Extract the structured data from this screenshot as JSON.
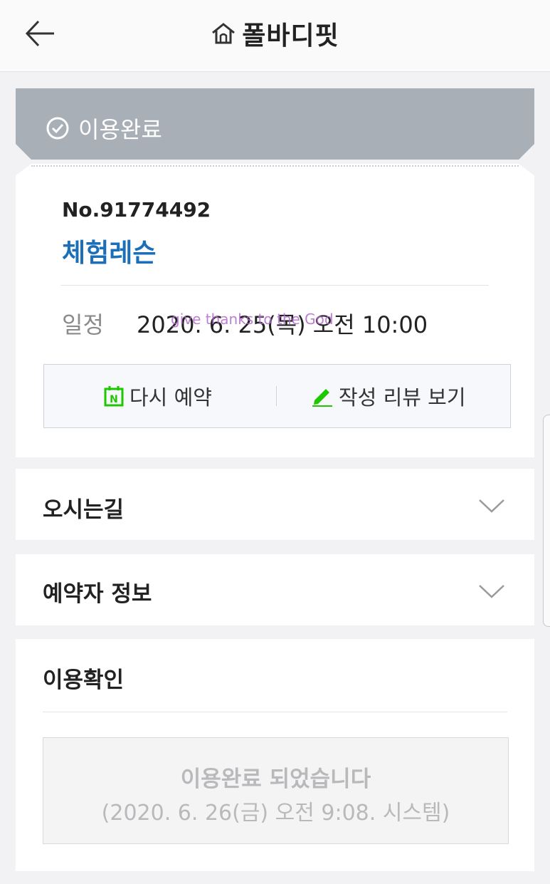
{
  "header": {
    "title": "폴바디핏",
    "back_icon": "arrow-left-icon",
    "home_icon": "home-icon"
  },
  "status": {
    "label": "이용완료",
    "icon": "check-circle-icon",
    "color": "#a8afb7"
  },
  "reservation": {
    "number": "No.91774492",
    "title": "체험레슨",
    "title_color": "#1a6fb8",
    "schedule_label": "일정",
    "schedule_value": "2020. 6. 25(목) 오전 10:00",
    "watermark": "give thanks to the God"
  },
  "actions": {
    "rebook_label": "다시 예약",
    "rebook_icon": "naver-calendar-icon",
    "review_label": "작성 리뷰 보기",
    "review_icon": "pencil-icon",
    "icon_color": "#1ec800"
  },
  "sections": {
    "directions_label": "오시는길",
    "booker_info_label": "예약자 정보",
    "confirm_label": "이용확인"
  },
  "confirmation": {
    "main": "이용완료 되었습니다",
    "sub": "(2020. 6. 26(금) 오전 9:08. 시스템)"
  }
}
